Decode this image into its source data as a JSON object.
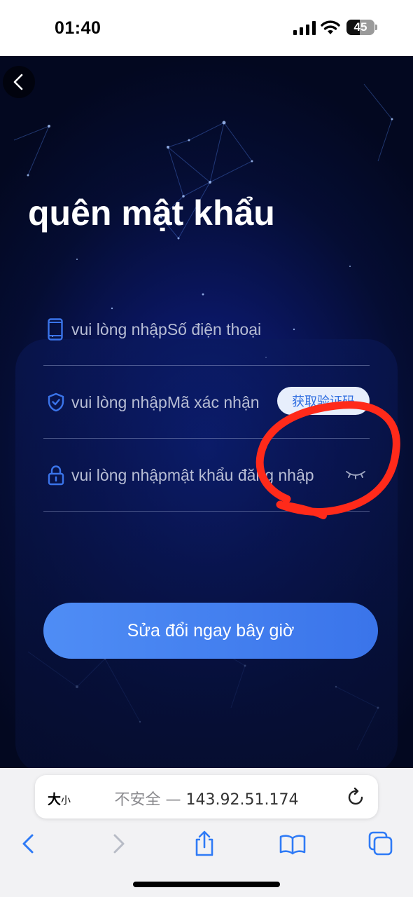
{
  "status_bar": {
    "time": "01:40",
    "battery": "45"
  },
  "page": {
    "title": "quên mật khẩu"
  },
  "form": {
    "phone_placeholder": "vui lòng nhậpSố điện thoại",
    "code_placeholder": "vui lòng nhậpMã xác nhận",
    "get_code_label": "获取验证码",
    "password_placeholder": "vui lòng nhậpmật khẩu đăng nhập",
    "submit_label": "Sửa đổi ngay bây giờ"
  },
  "browser": {
    "text_size_label": "大",
    "text_size_small": "小",
    "insecure_label": "不安全",
    "separator": " — ",
    "url": "143.92.51.174"
  },
  "icons": [
    "back-icon",
    "phone-icon",
    "shield-icon",
    "lock-icon",
    "eye-closed-icon",
    "reload-icon",
    "chevron-left-icon",
    "chevron-right-icon",
    "share-icon",
    "bookmarks-icon",
    "tabs-icon"
  ],
  "colors": {
    "accent": "#3a74ea",
    "background": "#0a1660",
    "annotation": "#ff2a1a"
  }
}
